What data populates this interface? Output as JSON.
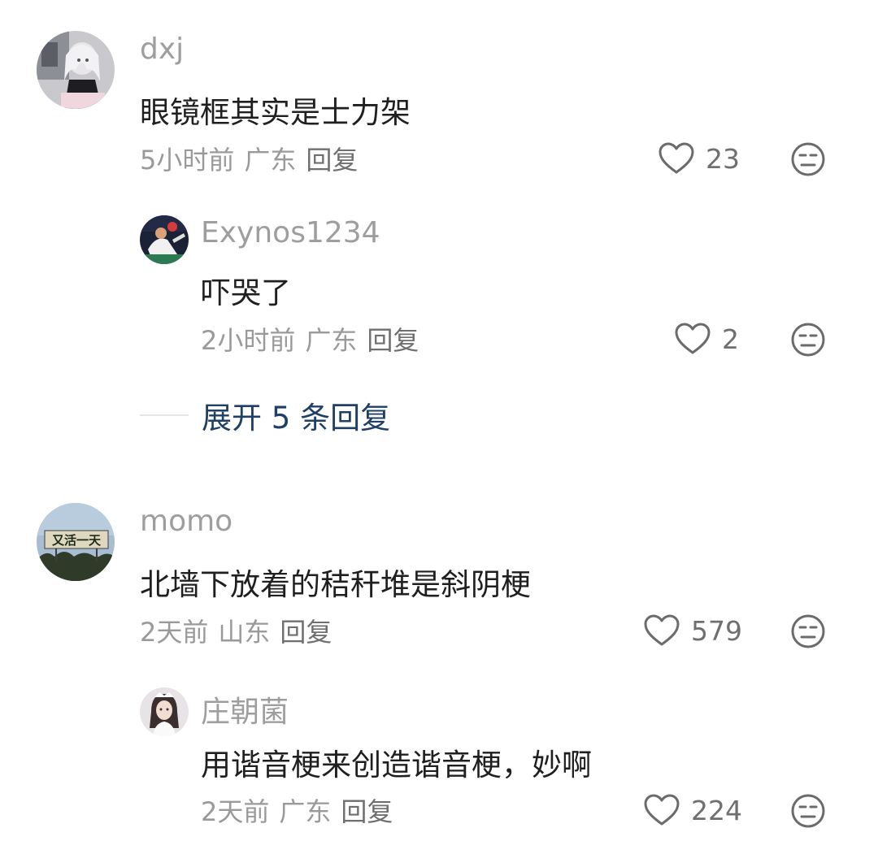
{
  "comments": [
    {
      "user": "dxj",
      "text": "眼镜框其实是士力架",
      "time": "5小时前",
      "location": "广东",
      "reply_label": "回复",
      "likes": "23",
      "replies": [
        {
          "user": "Exynos1234",
          "text": "吓哭了",
          "time": "2小时前",
          "location": "广东",
          "reply_label": "回复",
          "likes": "2"
        }
      ],
      "expand_label": "展开 5 条回复"
    },
    {
      "user": "momo",
      "avatar_text": "又活一天",
      "text": "北墙下放着的秸秆堆是斜阴梗",
      "time": "2天前",
      "location": "山东",
      "reply_label": "回复",
      "likes": "579",
      "replies": [
        {
          "user": "庄朝菌",
          "text": "用谐音梗来创造谐音梗，妙啊",
          "time": "2天前",
          "location": "广东",
          "reply_label": "回复",
          "likes": "224"
        }
      ]
    }
  ],
  "icons": {
    "like": "heart-outline-icon",
    "dislike": "neutral-face-icon"
  },
  "colors": {
    "username": "#9e9e9e",
    "text": "#1f1f1f",
    "meta": "#9a9a9a",
    "expand": "#1e3f66"
  }
}
